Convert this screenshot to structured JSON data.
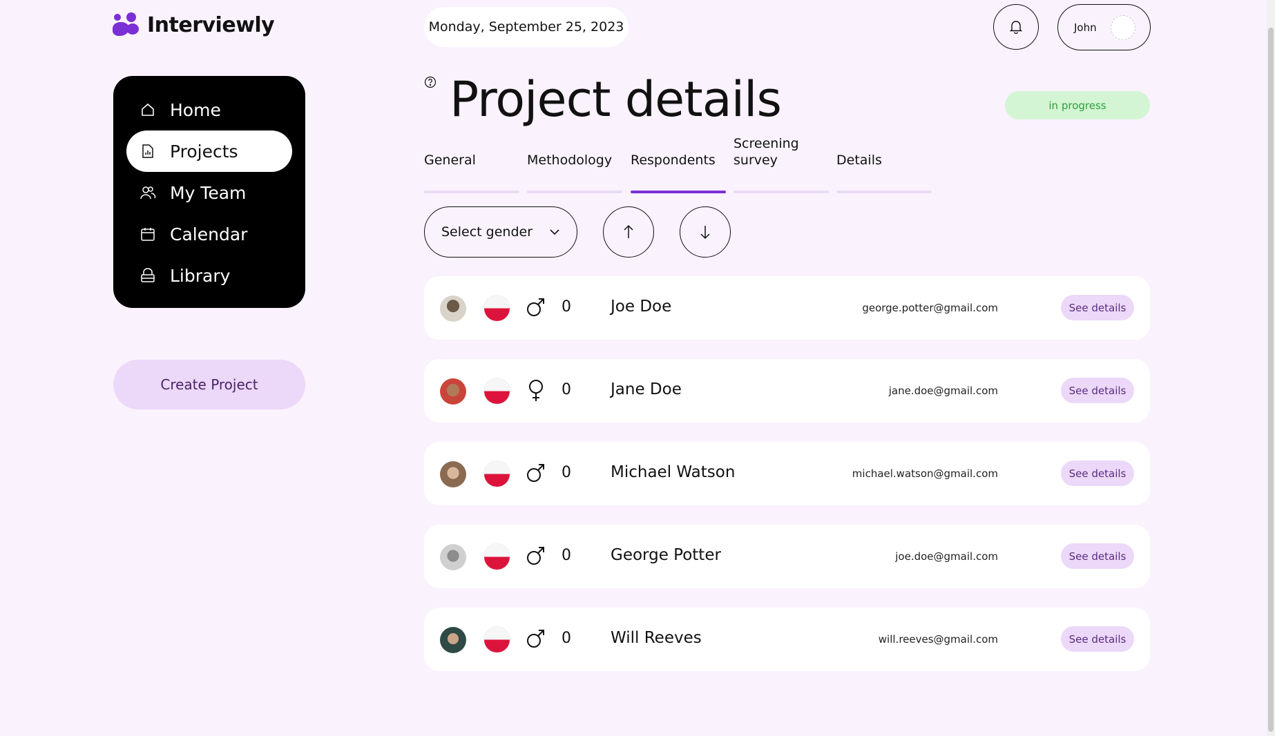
{
  "brand": {
    "name": "Interviewly",
    "accent": "#7b2fd6"
  },
  "header": {
    "date": "Monday, September 25, 2023",
    "user_name": "John",
    "bell_icon": "bell-icon"
  },
  "sidebar": {
    "items": [
      {
        "label": "Home",
        "icon": "home-icon",
        "active": false
      },
      {
        "label": "Projects",
        "icon": "document-chart-icon",
        "active": true
      },
      {
        "label": "My Team",
        "icon": "users-icon",
        "active": false
      },
      {
        "label": "Calendar",
        "icon": "calendar-icon",
        "active": false
      },
      {
        "label": "Library",
        "icon": "archive-icon",
        "active": false
      }
    ],
    "create_label": "Create Project"
  },
  "page": {
    "title": "Project details",
    "status": "in progress",
    "status_color": "#2f9e3a"
  },
  "tabs": [
    {
      "label": "General",
      "active": false
    },
    {
      "label": "Methodology",
      "active": false
    },
    {
      "label": "Respondents",
      "active": true
    },
    {
      "label": "Screening survey",
      "active": false
    },
    {
      "label": "Details",
      "active": false
    }
  ],
  "filters": {
    "gender_placeholder": "Select gender",
    "sort_up_icon": "arrow-up-icon",
    "sort_down_icon": "arrow-down-icon"
  },
  "respondents": [
    {
      "name": "Joe Doe",
      "gender": "male",
      "count": "0",
      "email": "george.potter@gmail.com",
      "action": "See details",
      "flag": "poland-flag"
    },
    {
      "name": "Jane Doe",
      "gender": "female",
      "count": "0",
      "email": "jane.doe@gmail.com",
      "action": "See details",
      "flag": "poland-flag"
    },
    {
      "name": "Michael Watson",
      "gender": "male",
      "count": "0",
      "email": "michael.watson@gmail.com",
      "action": "See details",
      "flag": "poland-flag"
    },
    {
      "name": "George Potter",
      "gender": "male",
      "count": "0",
      "email": "joe.doe@gmail.com",
      "action": "See details",
      "flag": "poland-flag"
    },
    {
      "name": "Will Reeves",
      "gender": "male",
      "count": "0",
      "email": "will.reeves@gmail.com",
      "action": "See details",
      "flag": "poland-flag"
    }
  ]
}
